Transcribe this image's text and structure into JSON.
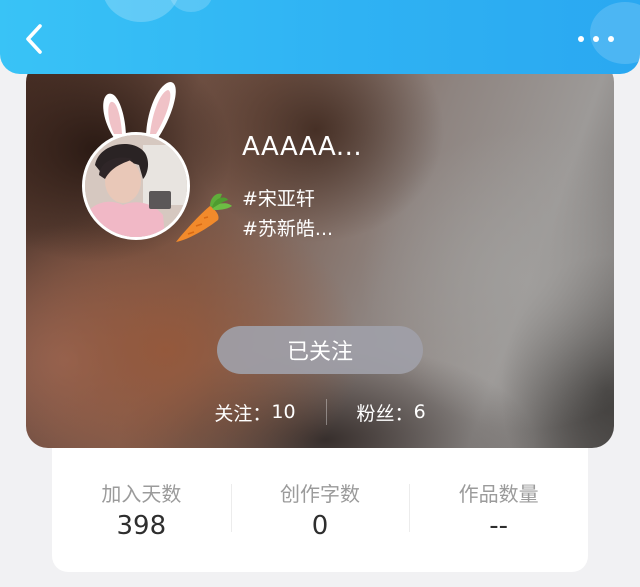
{
  "header": {
    "back_icon": "chevron-left-icon",
    "more_icon": "more-dots-icon",
    "accent_color": "#2fb2f3"
  },
  "profile": {
    "username": "AAAAA...",
    "tags": [
      "#宋亚轩",
      "#苏新皓..."
    ],
    "avatar_decorations": [
      "bunny-ears-icon",
      "carrot-icon"
    ],
    "follow_button_label": "已关注",
    "following_label": "关注：",
    "following_count": "10",
    "followers_label": "粉丝：",
    "followers_count": "6"
  },
  "stats": [
    {
      "label": "加入天数",
      "value": "398"
    },
    {
      "label": "创作字数",
      "value": "0"
    },
    {
      "label": "作品数量",
      "value": "--"
    }
  ]
}
